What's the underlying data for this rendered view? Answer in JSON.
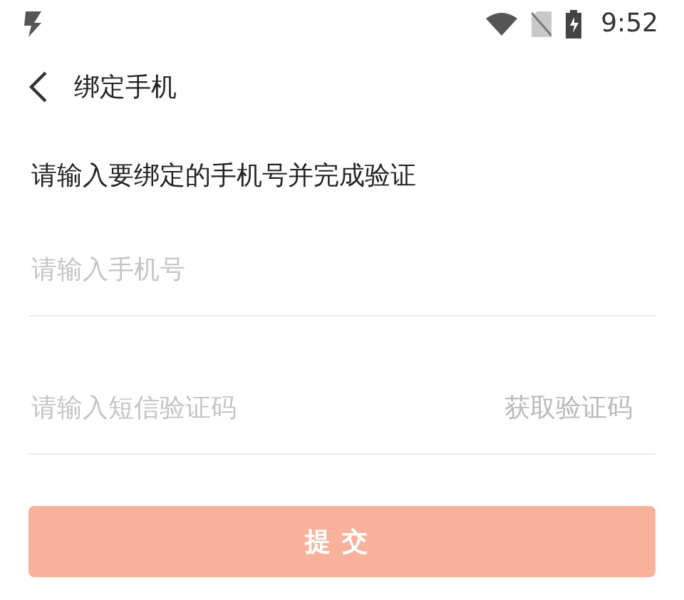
{
  "status_bar": {
    "time": "9:52"
  },
  "header": {
    "title": "绑定手机"
  },
  "prompt": "请输入要绑定的手机号并完成验证",
  "phone_field": {
    "placeholder": "请输入手机号"
  },
  "code_field": {
    "placeholder": "请输入短信验证码",
    "action": "获取验证码"
  },
  "submit": {
    "label": "提交",
    "disabled": true
  }
}
